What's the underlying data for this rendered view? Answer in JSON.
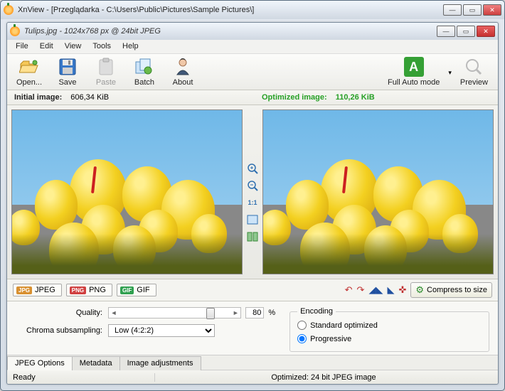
{
  "outer_title": "XnView - [Przeglądarka - C:\\Users\\Public\\Pictures\\Sample Pictures\\]",
  "inner_title": "Tulips.jpg - 1024x768 px @ 24bit JPEG",
  "menu": {
    "file": "File",
    "edit": "Edit",
    "view": "View",
    "tools": "Tools",
    "help": "Help"
  },
  "toolbar": {
    "open": "Open...",
    "save": "Save",
    "paste": "Paste",
    "batch": "Batch",
    "about": "About",
    "auto": "Full Auto mode",
    "preview": "Preview"
  },
  "sizes": {
    "initial_label": "Initial image:",
    "initial_value": "606,34 KiB",
    "optimized_label": "Optimized image:",
    "optimized_value": "110,26 KiB"
  },
  "formats": {
    "jpeg": "JPEG",
    "png": "PNG",
    "gif": "GIF"
  },
  "compress_btn": "Compress to size",
  "quality": {
    "label": "Quality:",
    "value": "80",
    "pct": "%",
    "thumb_pct": 78
  },
  "chroma": {
    "label": "Chroma subsampling:",
    "selected": "Low (4:2:2)"
  },
  "encoding": {
    "legend": "Encoding",
    "standard": "Standard optimized",
    "progressive": "Progressive",
    "selected": "progressive"
  },
  "tabs": {
    "jpeg": "JPEG Options",
    "meta": "Metadata",
    "adjust": "Image adjustments"
  },
  "status": {
    "ready": "Ready",
    "optimized": "Optimized: 24 bit JPEG image"
  }
}
